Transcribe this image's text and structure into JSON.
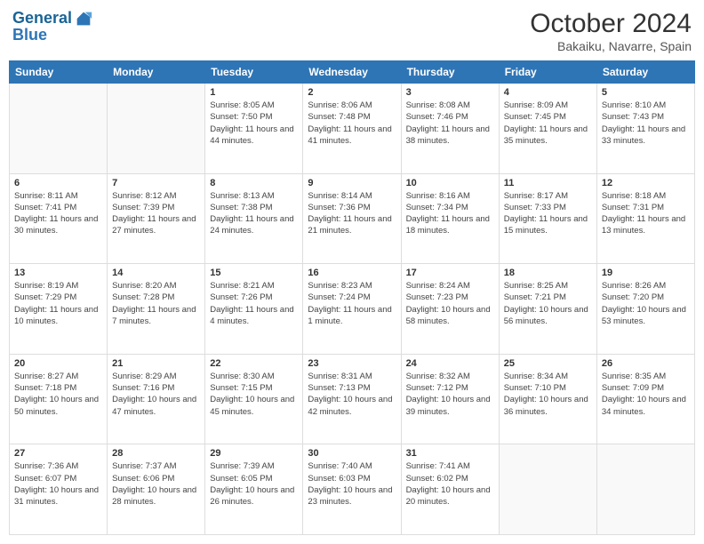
{
  "header": {
    "logo_line1": "General",
    "logo_line2": "Blue",
    "month_title": "October 2024",
    "location": "Bakaiku, Navarre, Spain"
  },
  "weekdays": [
    "Sunday",
    "Monday",
    "Tuesday",
    "Wednesday",
    "Thursday",
    "Friday",
    "Saturday"
  ],
  "weeks": [
    [
      {
        "day": "",
        "info": ""
      },
      {
        "day": "",
        "info": ""
      },
      {
        "day": "1",
        "info": "Sunrise: 8:05 AM\nSunset: 7:50 PM\nDaylight: 11 hours and 44 minutes."
      },
      {
        "day": "2",
        "info": "Sunrise: 8:06 AM\nSunset: 7:48 PM\nDaylight: 11 hours and 41 minutes."
      },
      {
        "day": "3",
        "info": "Sunrise: 8:08 AM\nSunset: 7:46 PM\nDaylight: 11 hours and 38 minutes."
      },
      {
        "day": "4",
        "info": "Sunrise: 8:09 AM\nSunset: 7:45 PM\nDaylight: 11 hours and 35 minutes."
      },
      {
        "day": "5",
        "info": "Sunrise: 8:10 AM\nSunset: 7:43 PM\nDaylight: 11 hours and 33 minutes."
      }
    ],
    [
      {
        "day": "6",
        "info": "Sunrise: 8:11 AM\nSunset: 7:41 PM\nDaylight: 11 hours and 30 minutes."
      },
      {
        "day": "7",
        "info": "Sunrise: 8:12 AM\nSunset: 7:39 PM\nDaylight: 11 hours and 27 minutes."
      },
      {
        "day": "8",
        "info": "Sunrise: 8:13 AM\nSunset: 7:38 PM\nDaylight: 11 hours and 24 minutes."
      },
      {
        "day": "9",
        "info": "Sunrise: 8:14 AM\nSunset: 7:36 PM\nDaylight: 11 hours and 21 minutes."
      },
      {
        "day": "10",
        "info": "Sunrise: 8:16 AM\nSunset: 7:34 PM\nDaylight: 11 hours and 18 minutes."
      },
      {
        "day": "11",
        "info": "Sunrise: 8:17 AM\nSunset: 7:33 PM\nDaylight: 11 hours and 15 minutes."
      },
      {
        "day": "12",
        "info": "Sunrise: 8:18 AM\nSunset: 7:31 PM\nDaylight: 11 hours and 13 minutes."
      }
    ],
    [
      {
        "day": "13",
        "info": "Sunrise: 8:19 AM\nSunset: 7:29 PM\nDaylight: 11 hours and 10 minutes."
      },
      {
        "day": "14",
        "info": "Sunrise: 8:20 AM\nSunset: 7:28 PM\nDaylight: 11 hours and 7 minutes."
      },
      {
        "day": "15",
        "info": "Sunrise: 8:21 AM\nSunset: 7:26 PM\nDaylight: 11 hours and 4 minutes."
      },
      {
        "day": "16",
        "info": "Sunrise: 8:23 AM\nSunset: 7:24 PM\nDaylight: 11 hours and 1 minute."
      },
      {
        "day": "17",
        "info": "Sunrise: 8:24 AM\nSunset: 7:23 PM\nDaylight: 10 hours and 58 minutes."
      },
      {
        "day": "18",
        "info": "Sunrise: 8:25 AM\nSunset: 7:21 PM\nDaylight: 10 hours and 56 minutes."
      },
      {
        "day": "19",
        "info": "Sunrise: 8:26 AM\nSunset: 7:20 PM\nDaylight: 10 hours and 53 minutes."
      }
    ],
    [
      {
        "day": "20",
        "info": "Sunrise: 8:27 AM\nSunset: 7:18 PM\nDaylight: 10 hours and 50 minutes."
      },
      {
        "day": "21",
        "info": "Sunrise: 8:29 AM\nSunset: 7:16 PM\nDaylight: 10 hours and 47 minutes."
      },
      {
        "day": "22",
        "info": "Sunrise: 8:30 AM\nSunset: 7:15 PM\nDaylight: 10 hours and 45 minutes."
      },
      {
        "day": "23",
        "info": "Sunrise: 8:31 AM\nSunset: 7:13 PM\nDaylight: 10 hours and 42 minutes."
      },
      {
        "day": "24",
        "info": "Sunrise: 8:32 AM\nSunset: 7:12 PM\nDaylight: 10 hours and 39 minutes."
      },
      {
        "day": "25",
        "info": "Sunrise: 8:34 AM\nSunset: 7:10 PM\nDaylight: 10 hours and 36 minutes."
      },
      {
        "day": "26",
        "info": "Sunrise: 8:35 AM\nSunset: 7:09 PM\nDaylight: 10 hours and 34 minutes."
      }
    ],
    [
      {
        "day": "27",
        "info": "Sunrise: 7:36 AM\nSunset: 6:07 PM\nDaylight: 10 hours and 31 minutes."
      },
      {
        "day": "28",
        "info": "Sunrise: 7:37 AM\nSunset: 6:06 PM\nDaylight: 10 hours and 28 minutes."
      },
      {
        "day": "29",
        "info": "Sunrise: 7:39 AM\nSunset: 6:05 PM\nDaylight: 10 hours and 26 minutes."
      },
      {
        "day": "30",
        "info": "Sunrise: 7:40 AM\nSunset: 6:03 PM\nDaylight: 10 hours and 23 minutes."
      },
      {
        "day": "31",
        "info": "Sunrise: 7:41 AM\nSunset: 6:02 PM\nDaylight: 10 hours and 20 minutes."
      },
      {
        "day": "",
        "info": ""
      },
      {
        "day": "",
        "info": ""
      }
    ]
  ]
}
